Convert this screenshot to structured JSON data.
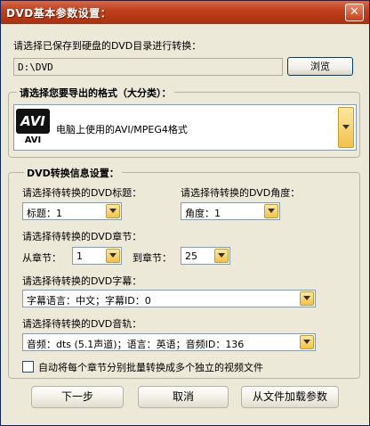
{
  "window": {
    "title": "DVD基本参数设置：",
    "close_glyph": "✕"
  },
  "source": {
    "prompt": "请选择已保存到硬盘的DVD目录进行转换：",
    "path_value": "D:\\DVD",
    "browse_label": "浏览"
  },
  "format_group": {
    "title": "请选择您要导出的格式（大分类）：",
    "logo_top": "AVI",
    "logo_bottom": "AVI",
    "selected": "电脑上使用的AVI/MPEG4格式"
  },
  "info_group": {
    "title": "DVD转换信息设置：",
    "title_label": "请选择待转换的DVD标题：",
    "title_value": "标题：1",
    "angle_label": "请选择待转换的DVD角度：",
    "angle_value": "角度：1",
    "chapter_label": "请选择待转换的DVD章节：",
    "from_label": "从章节：",
    "from_value": "1",
    "to_label": "到章节：",
    "to_value": "25",
    "subtitle_label": "请选择待转换的DVD字幕：",
    "subtitle_value": "字幕语言：中文；字幕ID：0",
    "audio_label": "请选择待转换的DVD音轨：",
    "audio_value": "音频：dts (5.1声道)；语言：英语；音频ID：136",
    "batch_checkbox_label": "自动将每个章节分别批量转换成多个独立的视频文件",
    "batch_checked": false
  },
  "footer": {
    "next_label": "下一步",
    "cancel_label": "取消",
    "load_label": "从文件加载参数"
  },
  "colors": {
    "titlebar": "#c0401c",
    "dialog_bg": "#ece9d8",
    "dropdown_accent": "#f1c24c"
  }
}
